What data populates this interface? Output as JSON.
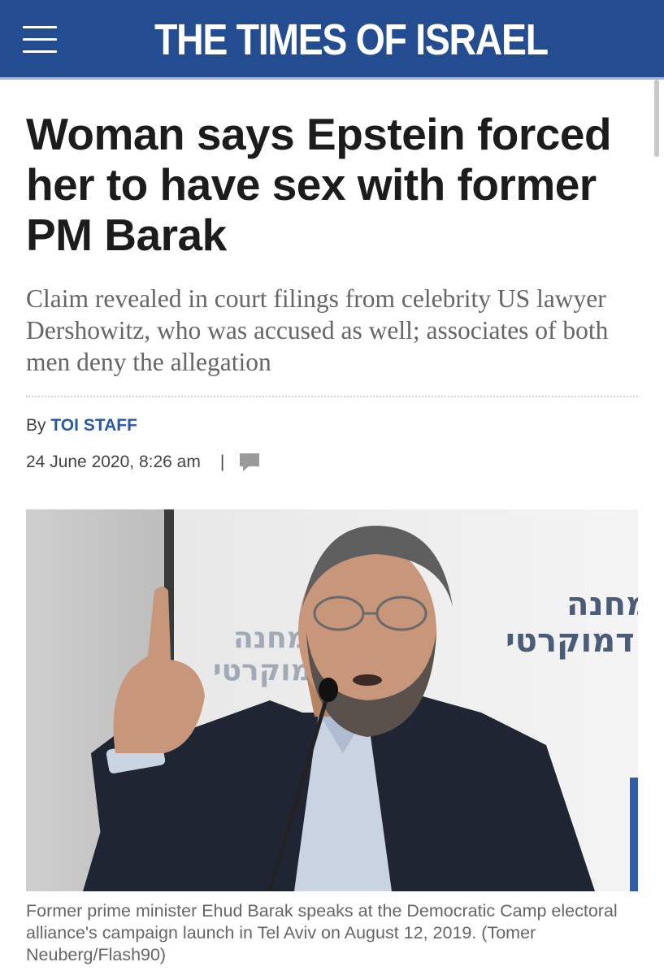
{
  "header": {
    "logo_text": "THE TIMES OF ISRAEL",
    "menu_icon": "hamburger-menu-icon",
    "background_color": "#234c91"
  },
  "article": {
    "headline": "Woman says Epstein forced her to have sex with former PM Barak",
    "subheadline": "Claim revealed in court filings from celebrity US lawyer Dershowitz, who was accused as well; associates of both men deny the allegation",
    "byline_prefix": "By",
    "author": "TOI STAFF",
    "date": "24 June 2020, 8:26 am",
    "separator": "|",
    "comment_icon": "comment-bubble-icon",
    "photo_wall_text": "מחנה\nדמוקרטי",
    "caption": "Former prime minister Ehud Barak speaks at the Democratic Camp electoral alliance's campaign launch in Tel Aviv on August 12, 2019. (Tomer Neuberg/Flash90)"
  },
  "colors": {
    "author_link": "#2a5aa8",
    "headline": "#1c1c1c",
    "subheadline": "#666666"
  }
}
